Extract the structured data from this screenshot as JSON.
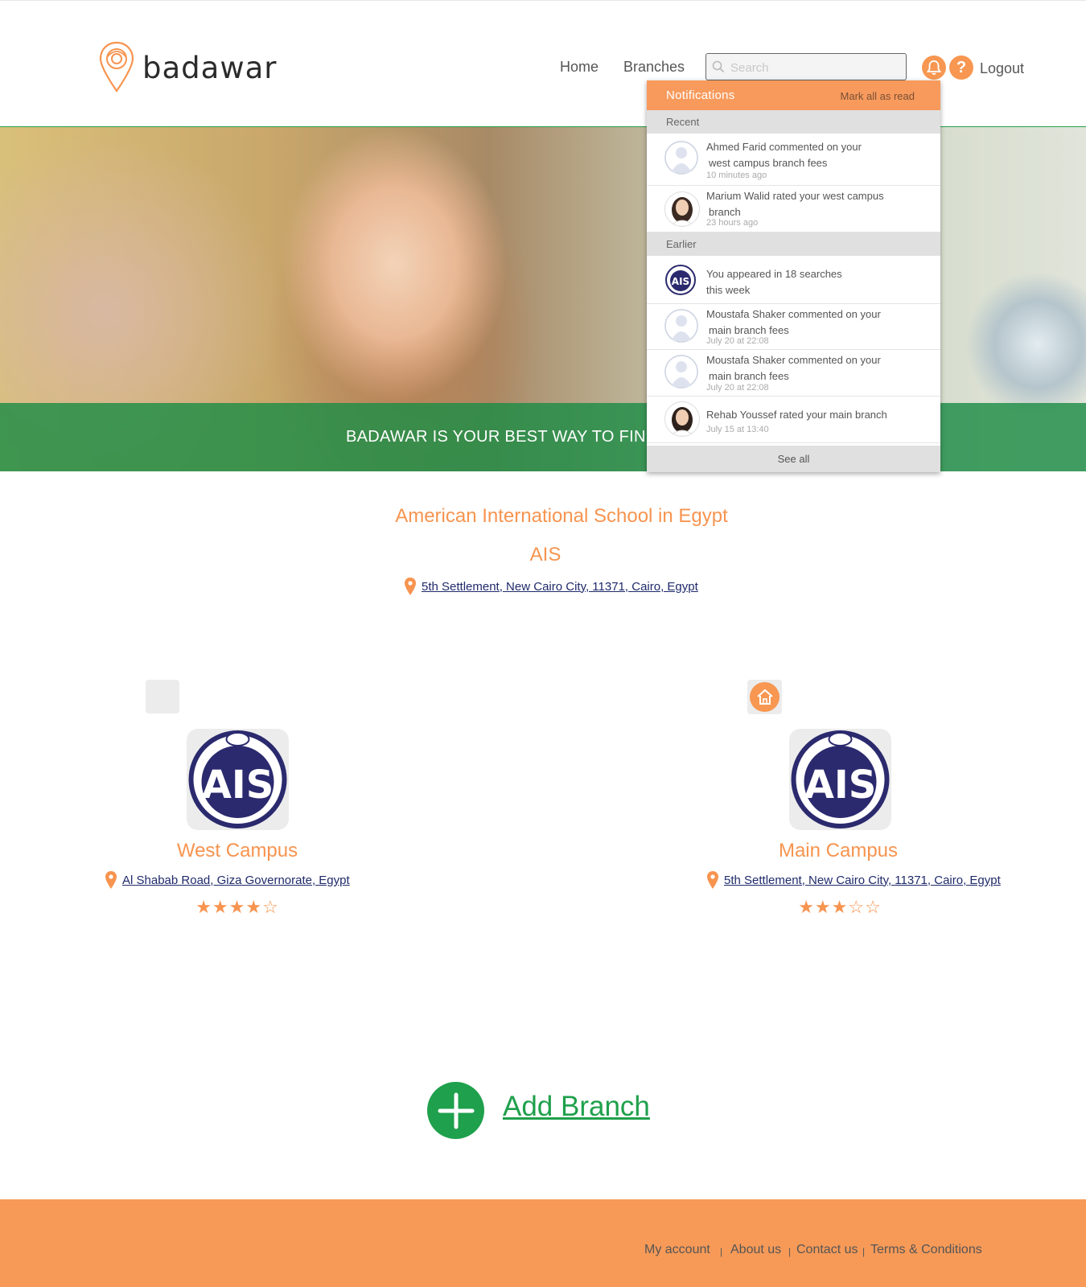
{
  "brand": {
    "name": "badawar"
  },
  "nav": {
    "home": "Home",
    "branches": "Branches",
    "logout": "Logout"
  },
  "search": {
    "placeholder": "Search",
    "value": ""
  },
  "hero": {
    "tagline": "BADAWAR IS YOUR BEST WAY TO FIND"
  },
  "notifications": {
    "title": "Notifications",
    "mark_all": "Mark all as read",
    "sections": {
      "recent": "Recent",
      "earlier": "Earlier"
    },
    "items": [
      {
        "line1": "Ahmed Farid commented on your",
        "line2": "west campus branch fees",
        "time": "10 minutes ago",
        "avatar": "placeholder"
      },
      {
        "line1": "Marium Walid rated your west campus",
        "line2": "branch",
        "time": "23 hours ago",
        "avatar": "person"
      },
      {
        "line1": "You appeared in 18 searches",
        "line2": "this week",
        "time": "",
        "avatar": "ais-logo"
      },
      {
        "line1": "Moustafa Shaker commented on your",
        "line2": "main branch fees",
        "time": "July 20 at 22:08",
        "avatar": "placeholder"
      },
      {
        "line1": "Moustafa Shaker commented on your",
        "line2": "main branch fees",
        "time": "July 20 at 22:08",
        "avatar": "placeholder"
      },
      {
        "line1": "Rehab Youssef rated your main branch",
        "line2": "",
        "time": "July 15 at 13:40",
        "avatar": "person"
      }
    ],
    "see_all": "See all"
  },
  "school": {
    "name": "American International School in Egypt",
    "abbr": "AIS",
    "address": "5th Settlement, New Cairo City, 11371, Cairo, Egypt"
  },
  "branches": [
    {
      "name": "West Campus",
      "address": "Al Shabab Road, Giza Governorate, Egypt",
      "rating": 4,
      "rating_stars": "★★★★☆",
      "is_main": false
    },
    {
      "name": "Main Campus",
      "address": "5th Settlement, New Cairo City, 11371, Cairo, Egypt",
      "rating": 3,
      "rating_stars": "★★★☆☆",
      "is_main": true
    }
  ],
  "add_branch": {
    "label": "Add Branch"
  },
  "footer": {
    "links": [
      "My account",
      "About us",
      "Contact us",
      "Terms & Conditions"
    ],
    "separator": "|"
  },
  "colors": {
    "accent": "#f79752",
    "green": "#1fa04c",
    "link": "#1f2a6b"
  }
}
